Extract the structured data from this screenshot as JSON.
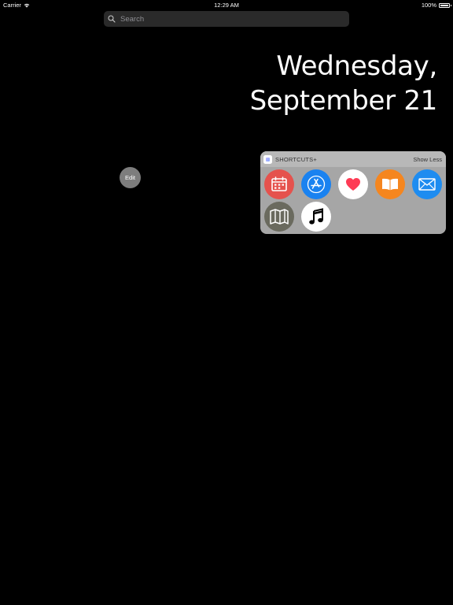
{
  "status_bar": {
    "carrier": "Carrier",
    "time": "12:29 AM",
    "battery": "100%"
  },
  "search": {
    "placeholder": "Search"
  },
  "date": {
    "line1": "Wednesday,",
    "line2": "September 21"
  },
  "edit_button": {
    "label": "Edit"
  },
  "widget": {
    "title": "SHORTCUTS+",
    "toggle_label": "Show Less",
    "shortcuts": [
      {
        "icon": "calendar-icon",
        "color": "#e5524d"
      },
      {
        "icon": "app-store-icon",
        "color": "#1a82f0"
      },
      {
        "icon": "health-icon",
        "color": "#ffffff"
      },
      {
        "icon": "books-icon",
        "color": "#f5861f"
      },
      {
        "icon": "mail-icon",
        "color": "#1e8cf0"
      },
      {
        "icon": "maps-icon",
        "color": "#6a6a5e"
      },
      {
        "icon": "music-icon",
        "color": "#ffffff"
      }
    ]
  }
}
